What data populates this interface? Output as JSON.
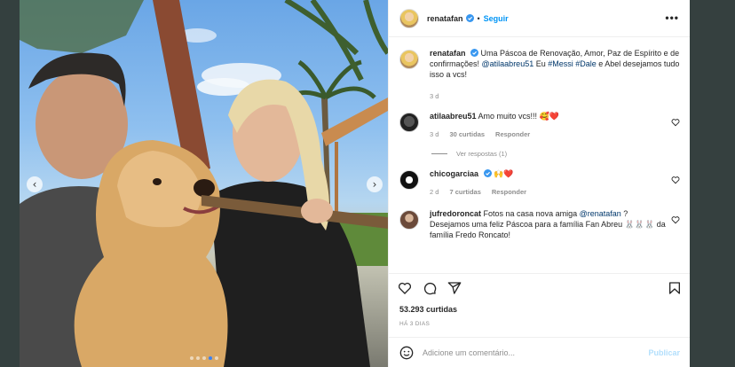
{
  "post": {
    "username": "renatafan",
    "follow_label": "Seguir",
    "separator": "•",
    "more_label": "•••",
    "caption": {
      "username": "renatafan",
      "text_part1": "Uma Páscoa de Renovação, Amor, Paz de Espírito e de confirmações! ",
      "mention": "@atilaabreu51",
      "text_part2": " Eu ",
      "hashtag1": "#Messi",
      "text_part3": " ",
      "hashtag2": "#Dale",
      "text_part4": " e Abel desejamos tudo isso a vcs!",
      "age": "3 d"
    },
    "comments": [
      {
        "username": "atilaabreu51",
        "text": "Amo muito vcs!!! 🥰❤️",
        "age": "3 d",
        "likes": "30 curtidas",
        "reply_label": "Responder",
        "view_replies": "Ver respostas (1)"
      },
      {
        "username": "chicogarciaa",
        "text": "🙌❤️",
        "age": "2 d",
        "likes": "7 curtidas",
        "reply_label": "Responder"
      },
      {
        "username": "jufredoroncat",
        "text_part1": "Fotos na casa nova amiga ",
        "mention": "@renatafan",
        "text_part2": " ? Desejamos uma feliz Páscoa para a família Fan Abreu 🐰🐰🐰 da família Fredo Roncato!"
      }
    ],
    "likes_count": "53.293 curtidas",
    "time_ago": "HÁ 3 DIAS",
    "comment_placeholder": "Adicione um comentário...",
    "post_button": "Publicar",
    "carousel": {
      "slides": 5,
      "active_index": 3
    }
  },
  "icons": {
    "prev": "‹",
    "next": "›",
    "like": "heart-icon",
    "comment": "comment-icon",
    "share": "share-icon",
    "save": "bookmark-icon",
    "emoji": "emoji-icon"
  },
  "colors": {
    "link_blue": "#0095f6",
    "mention_blue": "#00376b",
    "verified_blue": "#3897f0",
    "post_disabled": "#b2dffc"
  }
}
